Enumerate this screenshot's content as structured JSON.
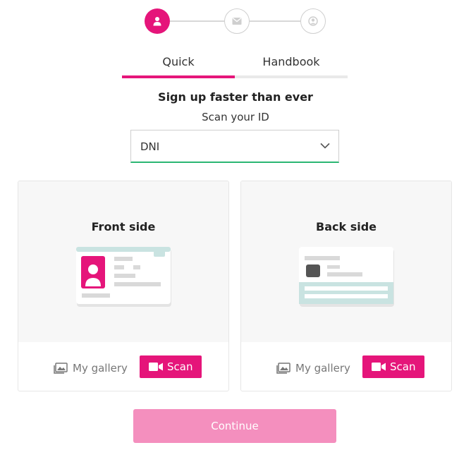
{
  "stepper": {
    "steps": [
      {
        "icon": "user-icon",
        "active": true
      },
      {
        "icon": "envelope-icon",
        "active": false
      },
      {
        "icon": "user-circle-icon",
        "active": false
      }
    ]
  },
  "tabs": [
    {
      "label": "Quick",
      "active": true
    },
    {
      "label": "Handbook",
      "active": false
    }
  ],
  "heading": "Sign up faster than ever",
  "subheading": "Scan your ID",
  "id_select": {
    "value": "DNI",
    "icon": "chevron-down-icon"
  },
  "cards": [
    {
      "title": "Front side",
      "gallery_label": "My gallery",
      "scan_label": "Scan"
    },
    {
      "title": "Back side",
      "gallery_label": "My gallery",
      "scan_label": "Scan"
    }
  ],
  "continue_label": "Continue",
  "colors": {
    "accent": "#e5157a",
    "continue_bg": "#f48fbe",
    "select_border": "#2bb673",
    "card_teal": "#c9e3e1"
  }
}
